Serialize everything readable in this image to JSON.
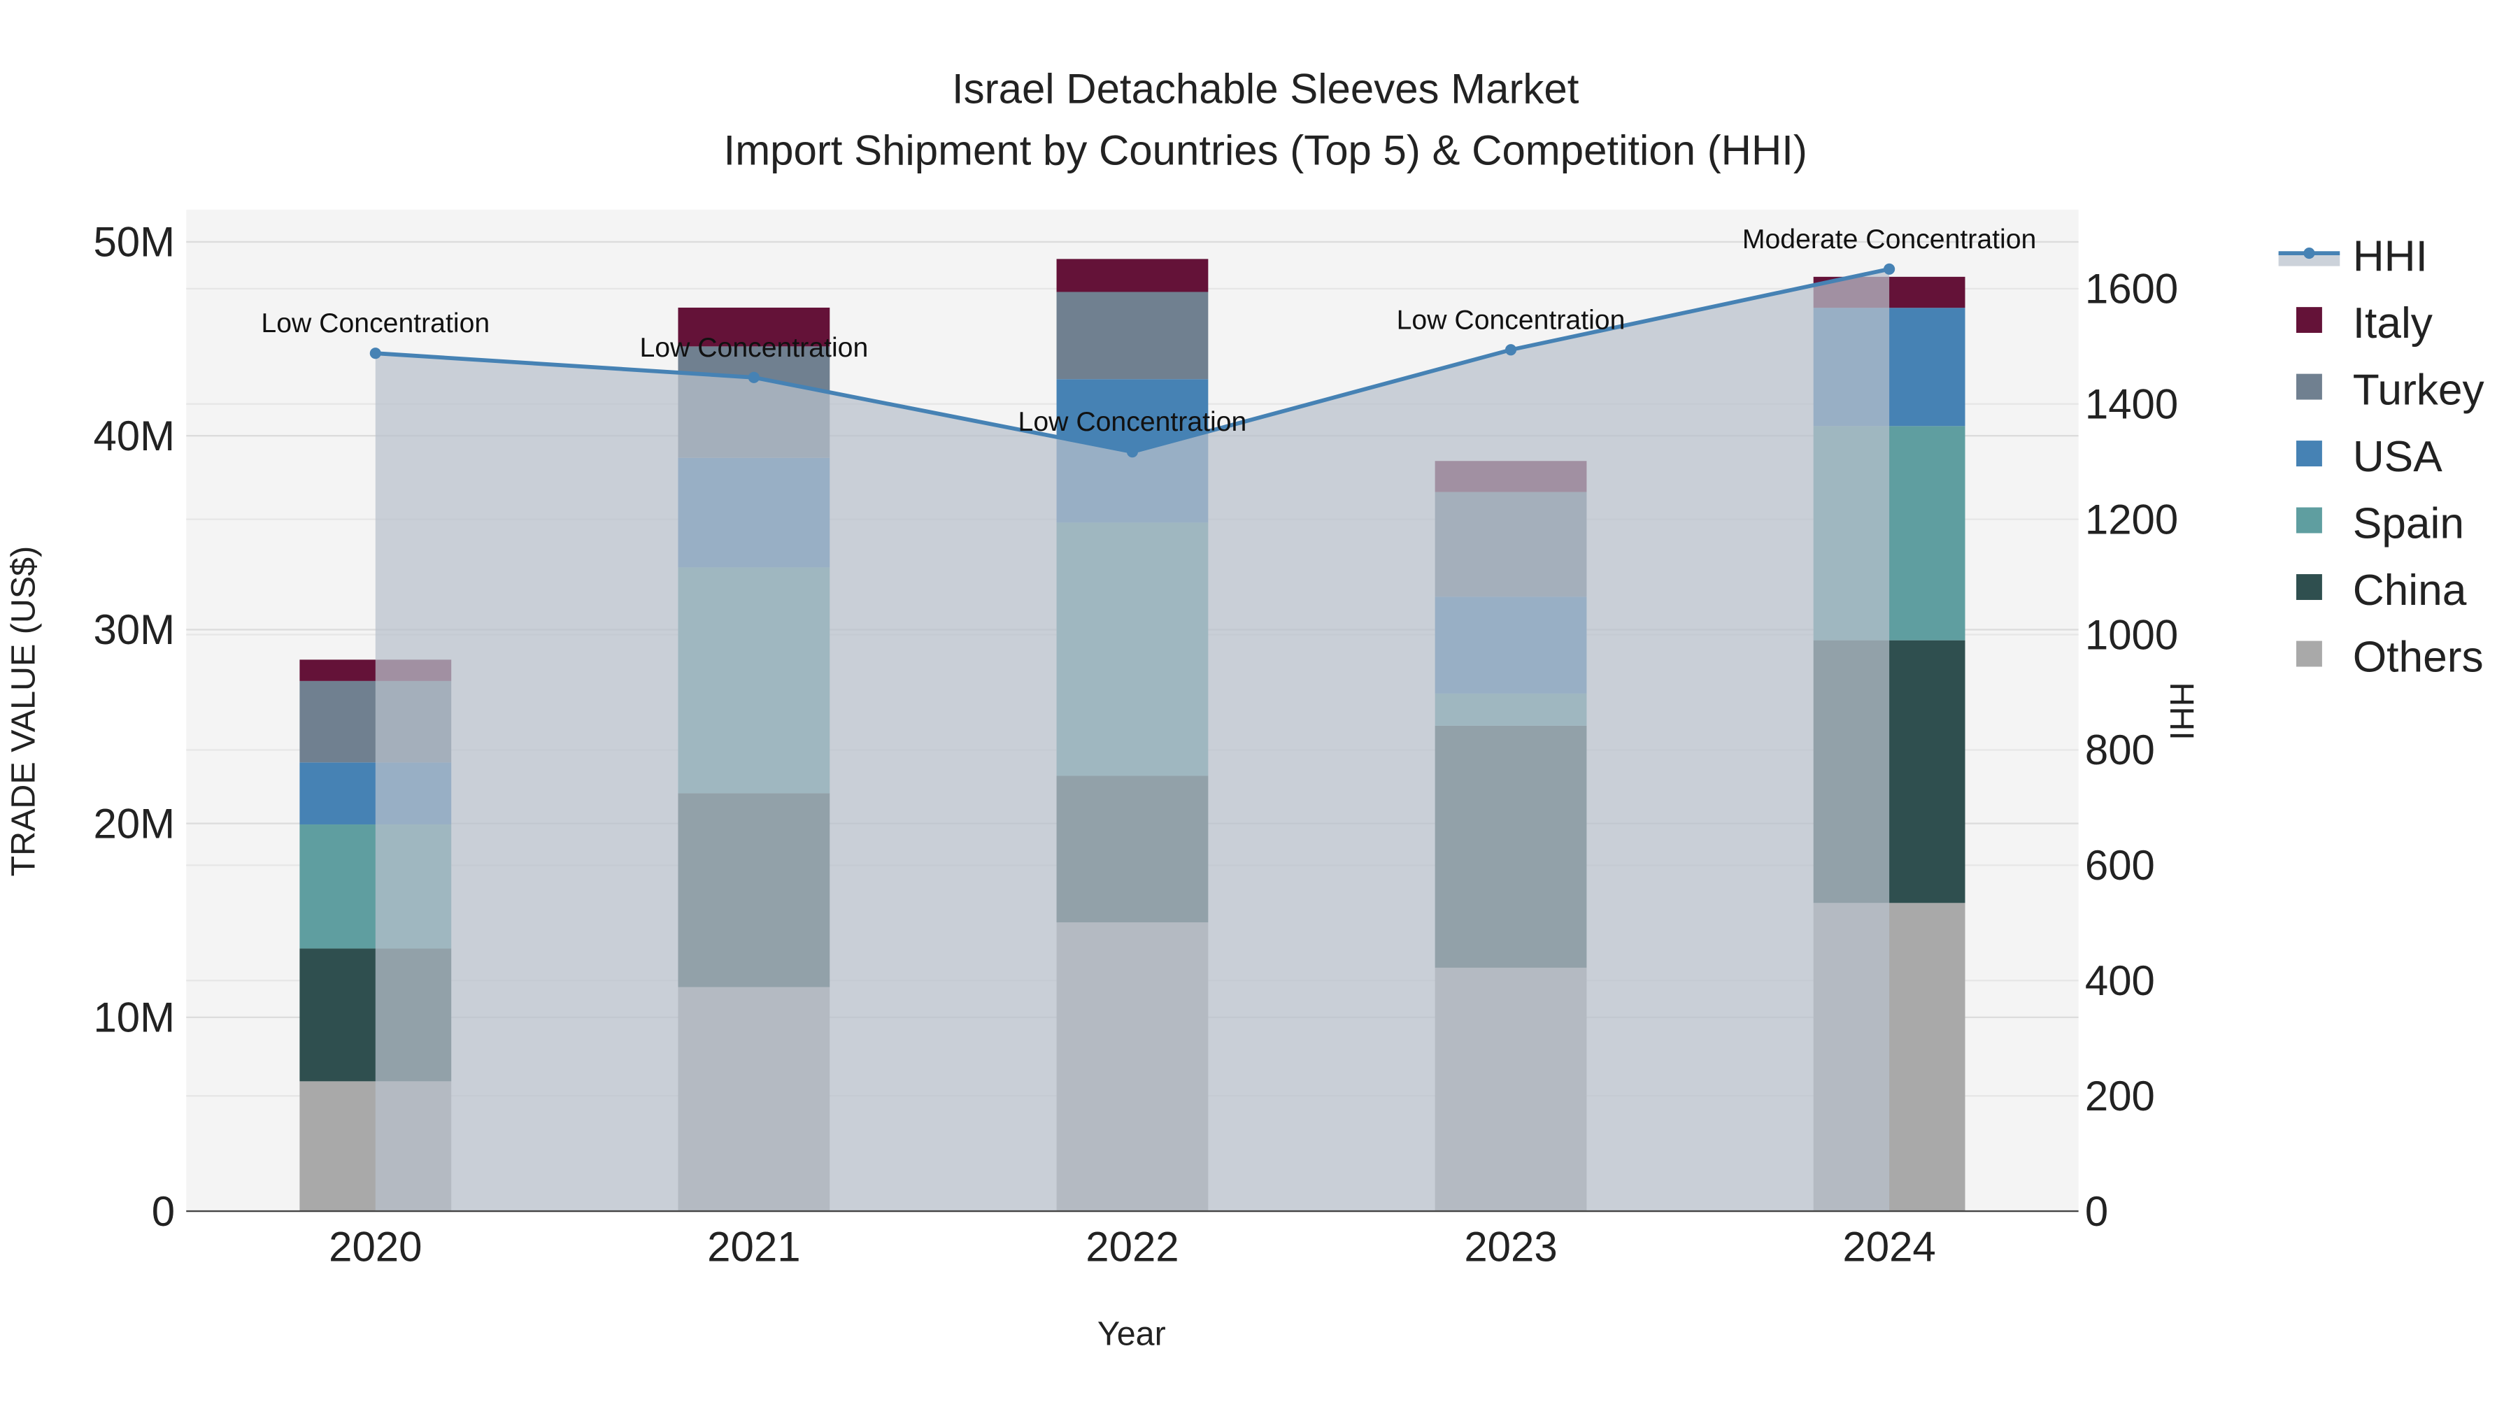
{
  "chart_data": {
    "type": "bar",
    "stacked": true,
    "title": "Israel Detachable Sleeves Market",
    "subtitle": "Import Shipment by Countries (Top 5) & Competition (HHI)",
    "xlabel": "Year",
    "ylabel": "TRADE VALUE (US$)",
    "y2label": "HHI",
    "categories": [
      "2020",
      "2021",
      "2022",
      "2023",
      "2024"
    ],
    "ylim": [
      0,
      52000000
    ],
    "yticks": [
      0,
      10000000,
      20000000,
      30000000,
      40000000,
      50000000
    ],
    "ytick_labels": [
      "0",
      "10M",
      "20M",
      "30M",
      "40M",
      "50M"
    ],
    "y2lim": [
      0,
      1730
    ],
    "y2ticks": [
      0,
      200,
      400,
      600,
      800,
      1000,
      1200,
      1400,
      1600
    ],
    "grid": true,
    "legend_position": "right",
    "series": [
      {
        "name": "Others",
        "color": "#a9a9a9",
        "values": [
          6700000,
          11560000,
          14900000,
          12560000,
          15900000
        ]
      },
      {
        "name": "China",
        "color": "#2f4f4f",
        "values": [
          6850000,
          10000000,
          7560000,
          12480000,
          13550000
        ]
      },
      {
        "name": "Spain",
        "color": "#5f9ea0",
        "values": [
          6400000,
          11650000,
          13060000,
          1660000,
          11050000
        ]
      },
      {
        "name": "USA",
        "color": "#4682b4",
        "values": [
          3200000,
          5650000,
          7400000,
          5000000,
          6100000
        ]
      },
      {
        "name": "Turkey",
        "color": "#708090",
        "values": [
          4200000,
          5750000,
          4500000,
          5400000,
          0
        ]
      },
      {
        "name": "Italy",
        "color": "#641238",
        "values": [
          1100000,
          2000000,
          1700000,
          1600000,
          1600000
        ]
      }
    ],
    "hhi": {
      "name": "HHI",
      "color": "#4682b4",
      "values": [
        1488,
        1446,
        1317,
        1494,
        1634
      ],
      "annotations": [
        "Low Concentration",
        "Low Concentration",
        "Low Concentration",
        "Low Concentration",
        "Moderate Concentration"
      ]
    },
    "legend_order": [
      "HHI",
      "Italy",
      "Turkey",
      "USA",
      "Spain",
      "China",
      "Others"
    ]
  }
}
